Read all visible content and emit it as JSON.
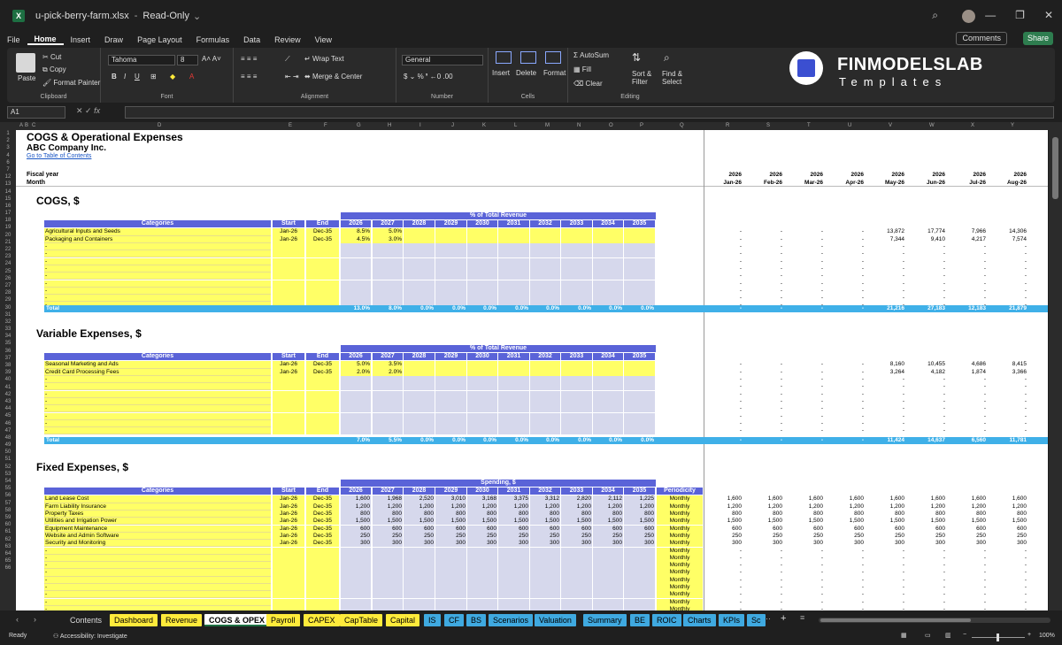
{
  "window": {
    "filename": "u-pick-berry-farm.xlsx",
    "status": "Read-Only"
  },
  "menu": [
    "File",
    "Home",
    "Insert",
    "Draw",
    "Page Layout",
    "Formulas",
    "Data",
    "Review",
    "View"
  ],
  "actions": {
    "comments": "Comments",
    "share": "Share"
  },
  "ribbon": {
    "paste": "Paste",
    "cut": "Cut",
    "copy": "Copy",
    "format_painter": "Format Painter",
    "clipboard": "Clipboard",
    "font_name": "Tahoma",
    "font_size": "8",
    "font": "Font",
    "wrap_text": "Wrap Text",
    "merge_center": "Merge & Center",
    "alignment": "Alignment",
    "number_format": "General",
    "number": "Number",
    "insert": "Insert",
    "delete": "Delete",
    "format": "Format",
    "cells": "Cells",
    "autosum": "AutoSum",
    "fill": "Fill",
    "clear": "Clear",
    "sort_filter": "Sort & Filter",
    "find_select": "Find & Select",
    "editing": "Editing"
  },
  "brand": {
    "name": "FINMODELSLAB",
    "sub": "Templates"
  },
  "formula_bar": {
    "name_box": "A1",
    "fx": "fx"
  },
  "sheet": {
    "title": "COGS & Operational Expenses",
    "company": "ABC Company Inc.",
    "toc_link": "Go to Table of Contents",
    "fiscal_year_label": "Fiscal year",
    "month_label": "Month",
    "timeline": {
      "years": [
        "2026",
        "2026",
        "2026",
        "2026",
        "2026",
        "2026",
        "2026",
        "2026"
      ],
      "months": [
        "Jan-26",
        "Feb-26",
        "Mar-26",
        "Apr-26",
        "May-26",
        "Jun-26",
        "Jul-26",
        "Aug-26"
      ]
    },
    "cogs": {
      "title": "COGS, $",
      "band": "% of Total Revenue",
      "cols": [
        "Categories",
        "Start",
        "End",
        "2026",
        "2027",
        "2028",
        "2029",
        "2030",
        "2031",
        "2032",
        "2033",
        "2034",
        "2035"
      ],
      "rows": [
        {
          "name": "Agricultural Inputs and Seeds",
          "start": "Jan-26",
          "end": "Dec-35",
          "pct": [
            "8.5%",
            "5.0%"
          ],
          "months": [
            "-",
            "-",
            "-",
            "-",
            "13,872",
            "17,774",
            "7,966",
            "14,306"
          ]
        },
        {
          "name": "Packaging and Containers",
          "start": "Jan-26",
          "end": "Dec-35",
          "pct": [
            "4.5%",
            "3.0%"
          ],
          "months": [
            "-",
            "-",
            "-",
            "-",
            "7,344",
            "9,410",
            "4,217",
            "7,574"
          ]
        }
      ],
      "total_label": "Total",
      "total_pct": [
        "13.0%",
        "8.0%",
        "0.0%",
        "0.0%",
        "0.0%",
        "0.0%",
        "0.0%",
        "0.0%",
        "0.0%",
        "0.0%"
      ],
      "total_months": [
        "-",
        "-",
        "-",
        "-",
        "21,216",
        "27,183",
        "12,183",
        "21,879"
      ]
    },
    "variable": {
      "title": "Variable Expenses, $",
      "band": "% of Total Revenue",
      "rows": [
        {
          "name": "Seasonal Marketing and Ads",
          "start": "Jan-26",
          "end": "Dec-35",
          "pct": [
            "5.0%",
            "3.5%"
          ],
          "months": [
            "-",
            "-",
            "-",
            "-",
            "8,160",
            "10,455",
            "4,686",
            "8,415"
          ]
        },
        {
          "name": "Credit Card Processing Fees",
          "start": "Jan-26",
          "end": "Dec-35",
          "pct": [
            "2.0%",
            "2.0%"
          ],
          "months": [
            "-",
            "-",
            "-",
            "-",
            "3,264",
            "4,182",
            "1,874",
            "3,366"
          ]
        }
      ],
      "total_label": "Total",
      "total_pct": [
        "7.0%",
        "5.5%",
        "0.0%",
        "0.0%",
        "0.0%",
        "0.0%",
        "0.0%",
        "0.0%",
        "0.0%",
        "0.0%"
      ],
      "total_months": [
        "-",
        "-",
        "-",
        "-",
        "11,424",
        "14,637",
        "6,560",
        "11,781"
      ]
    },
    "fixed": {
      "title": "Fixed Expenses, $",
      "band": "Spending, $",
      "periodicity_label": "Periodicity",
      "rows": [
        {
          "name": "Land Lease Cost",
          "start": "Jan-26",
          "end": "Dec-35",
          "vals": [
            "1,600",
            "1,968",
            "2,520",
            "3,010",
            "3,168",
            "3,375",
            "3,312",
            "2,820",
            "2,112",
            "1,225"
          ],
          "per": "Monthly",
          "months": [
            "1,600",
            "1,600",
            "1,600",
            "1,600",
            "1,600",
            "1,600",
            "1,600",
            "1,600"
          ]
        },
        {
          "name": "Farm Liability Insurance",
          "start": "Jan-26",
          "end": "Dec-35",
          "vals": [
            "1,200",
            "1,200",
            "1,200",
            "1,200",
            "1,200",
            "1,200",
            "1,200",
            "1,200",
            "1,200",
            "1,200"
          ],
          "per": "Monthly",
          "months": [
            "1,200",
            "1,200",
            "1,200",
            "1,200",
            "1,200",
            "1,200",
            "1,200",
            "1,200"
          ]
        },
        {
          "name": "Property Taxes",
          "start": "Jan-26",
          "end": "Dec-35",
          "vals": [
            "800",
            "800",
            "800",
            "800",
            "800",
            "800",
            "800",
            "800",
            "800",
            "800"
          ],
          "per": "Monthly",
          "months": [
            "800",
            "800",
            "800",
            "800",
            "800",
            "800",
            "800",
            "800"
          ]
        },
        {
          "name": "Utilities and Irrigation Power",
          "start": "Jan-26",
          "end": "Dec-35",
          "vals": [
            "1,500",
            "1,500",
            "1,500",
            "1,500",
            "1,500",
            "1,500",
            "1,500",
            "1,500",
            "1,500",
            "1,500"
          ],
          "per": "Monthly",
          "months": [
            "1,500",
            "1,500",
            "1,500",
            "1,500",
            "1,500",
            "1,500",
            "1,500",
            "1,500"
          ]
        },
        {
          "name": "Equipment Maintenance",
          "start": "Jan-26",
          "end": "Dec-35",
          "vals": [
            "600",
            "600",
            "600",
            "600",
            "600",
            "600",
            "600",
            "600",
            "600",
            "600"
          ],
          "per": "Monthly",
          "months": [
            "600",
            "600",
            "600",
            "600",
            "600",
            "600",
            "600",
            "600"
          ]
        },
        {
          "name": "Website and Admin Software",
          "start": "Jan-26",
          "end": "Dec-35",
          "vals": [
            "250",
            "250",
            "250",
            "250",
            "250",
            "250",
            "250",
            "250",
            "250",
            "250"
          ],
          "per": "Monthly",
          "months": [
            "250",
            "250",
            "250",
            "250",
            "250",
            "250",
            "250",
            "250"
          ]
        },
        {
          "name": "Security and Monitoring",
          "start": "Jan-26",
          "end": "Dec-35",
          "vals": [
            "300",
            "300",
            "300",
            "300",
            "300",
            "300",
            "300",
            "300",
            "300",
            "300"
          ],
          "per": "Monthly",
          "months": [
            "300",
            "300",
            "300",
            "300",
            "300",
            "300",
            "300",
            "300"
          ]
        }
      ],
      "empty_per": "Monthly"
    }
  },
  "tabs": [
    {
      "label": "Contents",
      "style": "plain"
    },
    {
      "label": "Dashboard",
      "style": "y"
    },
    {
      "label": "Revenue",
      "style": "y"
    },
    {
      "label": "COGS & OPEX",
      "style": "active"
    },
    {
      "label": "Payroll",
      "style": "y"
    },
    {
      "label": "CAPEX",
      "style": "y"
    },
    {
      "label": "CapTable",
      "style": "y"
    },
    {
      "label": "Capital",
      "style": "y"
    },
    {
      "label": "IS",
      "style": "b"
    },
    {
      "label": "CF",
      "style": "b"
    },
    {
      "label": "BS",
      "style": "b"
    },
    {
      "label": "Scenarios",
      "style": "b"
    },
    {
      "label": "Valuation",
      "style": "b"
    },
    {
      "label": "Summary",
      "style": "b"
    },
    {
      "label": "BE",
      "style": "b"
    },
    {
      "label": "ROIC",
      "style": "b"
    },
    {
      "label": "Charts",
      "style": "b"
    },
    {
      "label": "KPIs",
      "style": "b"
    },
    {
      "label": "Sc",
      "style": "b"
    }
  ],
  "status": {
    "ready": "Ready",
    "accessibility": "Accessibility: Investigate",
    "zoom": "100%"
  },
  "colors": {
    "header": "#5a63d8",
    "input": "#ffff66",
    "total": "#3fb0e8",
    "grid": "#d6d8ec"
  }
}
